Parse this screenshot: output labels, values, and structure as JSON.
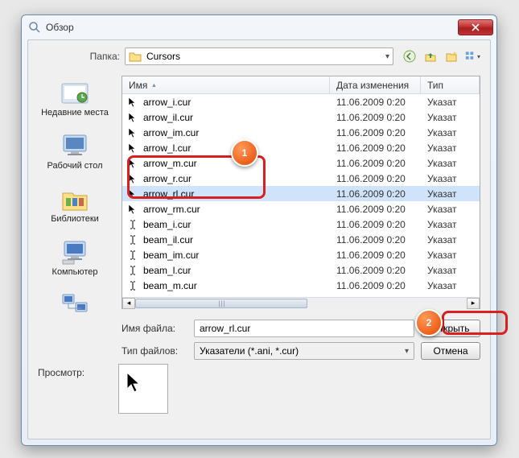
{
  "dialog": {
    "title": "Обзор"
  },
  "folder": {
    "label": "Папка:",
    "current": "Cursors"
  },
  "places": [
    {
      "label": "Недавние места"
    },
    {
      "label": "Рабочий стол"
    },
    {
      "label": "Библиотеки"
    },
    {
      "label": "Компьютер"
    },
    {
      "label": ""
    }
  ],
  "columns": {
    "name": "Имя",
    "date": "Дата изменения",
    "type": "Тип"
  },
  "files": [
    {
      "name": "arrow_i.cur",
      "date": "11.06.2009 0:20",
      "type": "Указат"
    },
    {
      "name": "arrow_il.cur",
      "date": "11.06.2009 0:20",
      "type": "Указат"
    },
    {
      "name": "arrow_im.cur",
      "date": "11.06.2009 0:20",
      "type": "Указат"
    },
    {
      "name": "arrow_l.cur",
      "date": "11.06.2009 0:20",
      "type": "Указат"
    },
    {
      "name": "arrow_m.cur",
      "date": "11.06.2009 0:20",
      "type": "Указат"
    },
    {
      "name": "arrow_r.cur",
      "date": "11.06.2009 0:20",
      "type": "Указат"
    },
    {
      "name": "arrow_rl.cur",
      "date": "11.06.2009 0:20",
      "type": "Указат",
      "selected": true
    },
    {
      "name": "arrow_rm.cur",
      "date": "11.06.2009 0:20",
      "type": "Указат"
    },
    {
      "name": "beam_i.cur",
      "date": "11.06.2009 0:20",
      "type": "Указат"
    },
    {
      "name": "beam_il.cur",
      "date": "11.06.2009 0:20",
      "type": "Указат"
    },
    {
      "name": "beam_im.cur",
      "date": "11.06.2009 0:20",
      "type": "Указат"
    },
    {
      "name": "beam_l.cur",
      "date": "11.06.2009 0:20",
      "type": "Указат"
    },
    {
      "name": "beam_m.cur",
      "date": "11.06.2009 0:20",
      "type": "Указат"
    }
  ],
  "filename": {
    "label": "Имя файла:",
    "value": "arrow_rl.cur"
  },
  "filetype": {
    "label": "Тип файлов:",
    "value": "Указатели (*.ani, *.cur)"
  },
  "buttons": {
    "open": "Открыть",
    "cancel": "Отмена"
  },
  "preview": {
    "label": "Просмотр:"
  },
  "callouts": {
    "one": "1",
    "two": "2"
  }
}
